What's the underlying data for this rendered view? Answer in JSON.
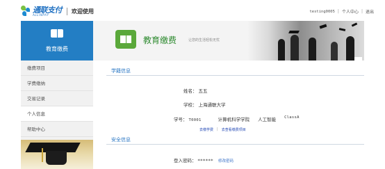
{
  "header": {
    "logo_cn": "通联支付",
    "logo_en": "ALLINPAY",
    "welcome": "欢迎使用",
    "username": "testing0005",
    "user_center": "个人中心",
    "logout": "退出"
  },
  "sidebar": {
    "title": "教育缴费",
    "items": [
      {
        "label": "缴费项目",
        "active": false
      },
      {
        "label": "学费缴纳",
        "active": false
      },
      {
        "label": "交易记录",
        "active": false
      },
      {
        "label": "个人信息",
        "active": true
      },
      {
        "label": "帮助中心",
        "active": false
      }
    ]
  },
  "banner": {
    "title": "教育缴费",
    "subtitle": "让您的生活轻松无忧"
  },
  "school_section": {
    "title": "学籍信息",
    "name_label": "姓名：",
    "name_value": "五五",
    "school_label": "学校：",
    "school_value": "上海通联大学",
    "student_id_label": "学号：",
    "student_id_value": "T0001",
    "college": "计算机科学学院",
    "major": "人工智能",
    "class": "ClassA",
    "link_pay": "去缴学费",
    "link_view": "去查看缴费项目"
  },
  "security_section": {
    "title": "安全信息",
    "password_label": "登入密码：",
    "password_value": "******",
    "edit_label": "修改密码"
  },
  "colors": {
    "brand_blue": "#237ec4",
    "banner_green": "#5aa83a",
    "link_blue": "#2248b5"
  }
}
